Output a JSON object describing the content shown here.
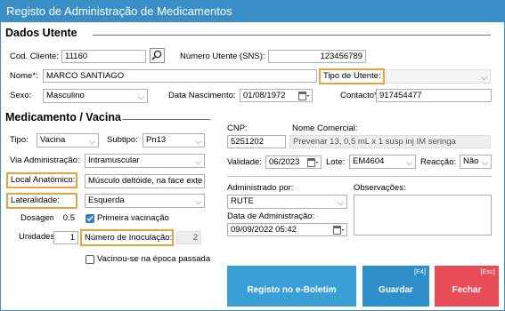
{
  "window": {
    "title": "Registo de Administração de Medicamentos"
  },
  "utente": {
    "section_title": "Dados Utente",
    "cod_cliente_label": "Cod. Cliente:",
    "cod_cliente_value": "11160",
    "numero_utente_label": "Número Utente (SNS):",
    "numero_utente_value": "123456789",
    "nome_label": "Nome*:",
    "nome_value": "MARCO SANTIAGO",
    "tipo_utente_label": "Tipo de Utente:",
    "tipo_utente_value": "",
    "sexo_label": "Sexo:",
    "sexo_value": "Masculino",
    "data_nascimento_label": "Data Nascimento:",
    "data_nascimento_value": "01/08/1972",
    "contacto_label": "Contacto*:",
    "contacto_value": "917454477"
  },
  "medicamento": {
    "section_title": "Medicamento / Vacina",
    "tipo_label": "Tipo:",
    "tipo_value": "Vacina",
    "subtipo_label": "Subtipo:",
    "subtipo_value": "Pn13",
    "via_label": "Via Administração:",
    "via_value": "Intramuscular",
    "local_label": "Local Anatómico:",
    "local_value": "Músculo deltóide, na face exte",
    "lateralidade_label": "Lateralidade:",
    "lateralidade_value": "Esquerda",
    "dosagem_label": "Dosagem:",
    "dosagem_value": "0.5",
    "primeira_vacinacao_label": "Primeira vacinação",
    "primeira_vacinacao_checked": true,
    "unidades_label": "Unidades:",
    "unidades_value": "1",
    "numero_inoculacao_label": "Número de Inoculação:",
    "numero_inoculacao_value": "2",
    "vacinou_label": "Vacinou-se na época passada",
    "vacinou_checked": false,
    "cnp_label": "CNP:",
    "cnp_value": "5251202",
    "nome_comercial_label": "Nome Comercial:",
    "nome_comercial_value": "Prevenar 13, 0,5 mL x 1 susp inj IM seringa",
    "validade_label": "Validade:",
    "validade_value": "06/2023",
    "lote_label": "Lote:",
    "lote_value": "EM4604",
    "reaccao_label": "Reacção:",
    "reaccao_value": "Não",
    "administrado_label": "Administrado por:",
    "administrado_value": "RUTE",
    "data_administracao_label": "Data de Administração:",
    "data_administracao_value": "09/09/2022 05:42",
    "observacoes_label": "Observações:",
    "observacoes_value": ""
  },
  "buttons": {
    "registo_label": "Registo no e-Boletim",
    "guardar_label": "Guardar",
    "guardar_key": "[F4]",
    "fechar_label": "Fechar",
    "fechar_key": "[Esc]"
  },
  "colors": {
    "titlebar": "#3a8fc7",
    "registo_button": "#3a9fd6",
    "guardar_button": "#2f8fca",
    "fechar_button": "#e84d57",
    "highlight": "#e8a33b"
  },
  "icons": {
    "search": "magnifier-icon",
    "calendar": "calendar-icon",
    "dropdown": "chevron-down-icon",
    "checkbox": "checkbox-icon"
  }
}
